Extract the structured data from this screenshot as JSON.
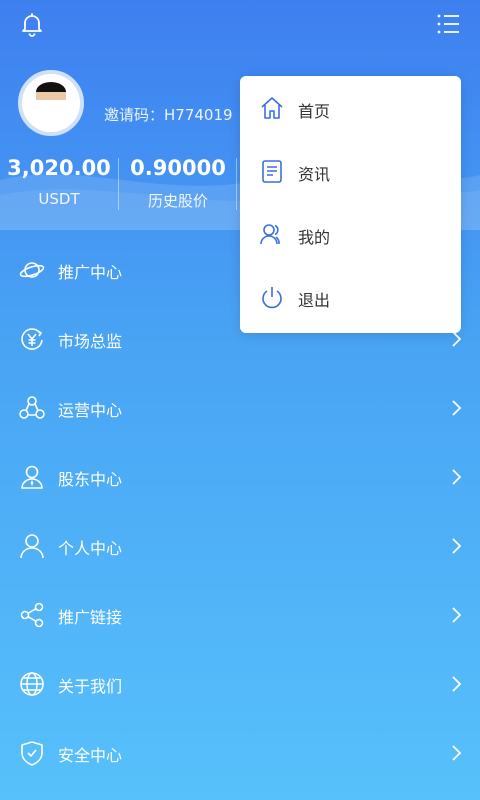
{
  "header": {
    "notification_icon": "bell-icon",
    "menu_icon": "list-menu-icon"
  },
  "profile": {
    "invite_text": "邀请码：H774019"
  },
  "stats": [
    {
      "value": "3,020.00",
      "label": "USDT"
    },
    {
      "value": "0.90000",
      "label": "历史股价"
    }
  ],
  "menu": [
    {
      "label": "推广中心",
      "icon": "planet-icon"
    },
    {
      "label": "市场总监",
      "icon": "yen-circle-icon"
    },
    {
      "label": "运营中心",
      "icon": "network-icon"
    },
    {
      "label": "股东中心",
      "icon": "shareholder-icon"
    },
    {
      "label": "个人中心",
      "icon": "user-icon"
    },
    {
      "label": "推广链接",
      "icon": "share-icon"
    },
    {
      "label": "关于我们",
      "icon": "globe-icon"
    },
    {
      "label": "安全中心",
      "icon": "shield-icon"
    }
  ],
  "dropdown": [
    {
      "label": "首页",
      "icon": "home-icon"
    },
    {
      "label": "资讯",
      "icon": "news-icon"
    },
    {
      "label": "我的",
      "icon": "users-icon"
    },
    {
      "label": "退出",
      "icon": "power-icon"
    }
  ],
  "colors": {
    "accent": "#3b6fe0",
    "gradient_top": "#3e7ff0",
    "gradient_bottom": "#57c1fb"
  }
}
